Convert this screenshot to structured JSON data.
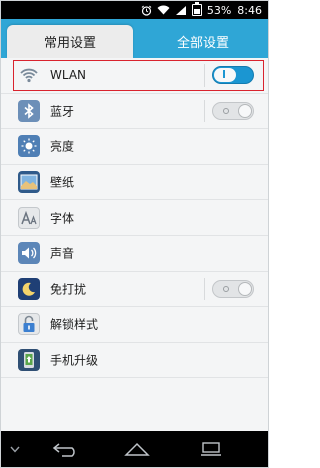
{
  "status_bar": {
    "battery": "53%",
    "time": "8:46",
    "icons": [
      "alarm-icon",
      "wifi-icon",
      "signal-icon",
      "battery-icon"
    ]
  },
  "tabs": {
    "active": "常用设置",
    "inactive": "全部设置"
  },
  "settings": {
    "wlan": "WLAN",
    "bluetooth": "蓝牙",
    "brightness": "亮度",
    "wallpaper": "壁纸",
    "font": "字体",
    "sound": "声音",
    "dnd": "免打扰",
    "lock_style": "解锁样式",
    "update": "手机升级"
  },
  "toggles": {
    "wlan": "on",
    "bluetooth": "off",
    "dnd": "off"
  },
  "colors": {
    "accent": "#2fa6d6",
    "toggle_on": "#1b96d2",
    "highlight": "#d9232e"
  },
  "navbar": {
    "icons": [
      "chevron-down-icon",
      "back-icon",
      "home-icon",
      "recent-apps-icon"
    ]
  }
}
